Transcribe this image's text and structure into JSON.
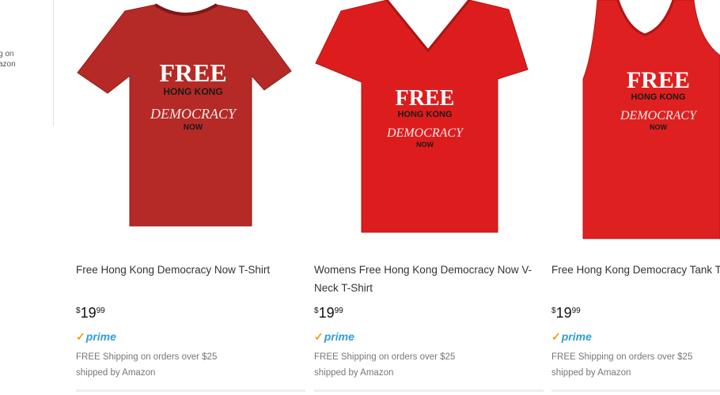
{
  "sidebar": {
    "line1": "g on",
    "line2": "azon"
  },
  "products": [
    {
      "title": "Free Hong Kong Democracy Now T-Shirt",
      "price": {
        "currency": "$",
        "whole": "19",
        "cents": "99"
      },
      "prime_label": "prime",
      "shipping": "FREE Shipping on orders over $25",
      "shipped_by": "shipped by Amazon",
      "shirt_print": {
        "free": "FREE",
        "hong_kong": "HONG KONG",
        "democracy": "DEMOCRACY",
        "now": "NOW"
      },
      "shirt_color": "#b52a26"
    },
    {
      "title": "Womens Free Hong Kong Democracy Now V-Neck T-Shirt",
      "price": {
        "currency": "$",
        "whole": "19",
        "cents": "99"
      },
      "prime_label": "prime",
      "shipping": "FREE Shipping on orders over $25",
      "shipped_by": "shipped by Amazon",
      "shirt_print": {
        "free": "FREE",
        "hong_kong": "HONG KONG",
        "democracy": "DEMOCRACY",
        "now": "NOW"
      },
      "shirt_color": "#dd1d1d"
    },
    {
      "title": "Free Hong Kong Democracy Tank Top",
      "price": {
        "currency": "$",
        "whole": "19",
        "cents": "99"
      },
      "prime_label": "prime",
      "shipping": "FREE Shipping on orders over $25",
      "shipped_by": "shipped by Amazon",
      "shirt_print": {
        "free": "FREE",
        "hong_kong": "HONG KONG",
        "democracy": "DEMOCRACY",
        "now": "NOW"
      },
      "shirt_color": "#df2020"
    }
  ],
  "colors": {
    "prime_blue": "#2f9fd6",
    "prime_check": "#f39c12"
  }
}
